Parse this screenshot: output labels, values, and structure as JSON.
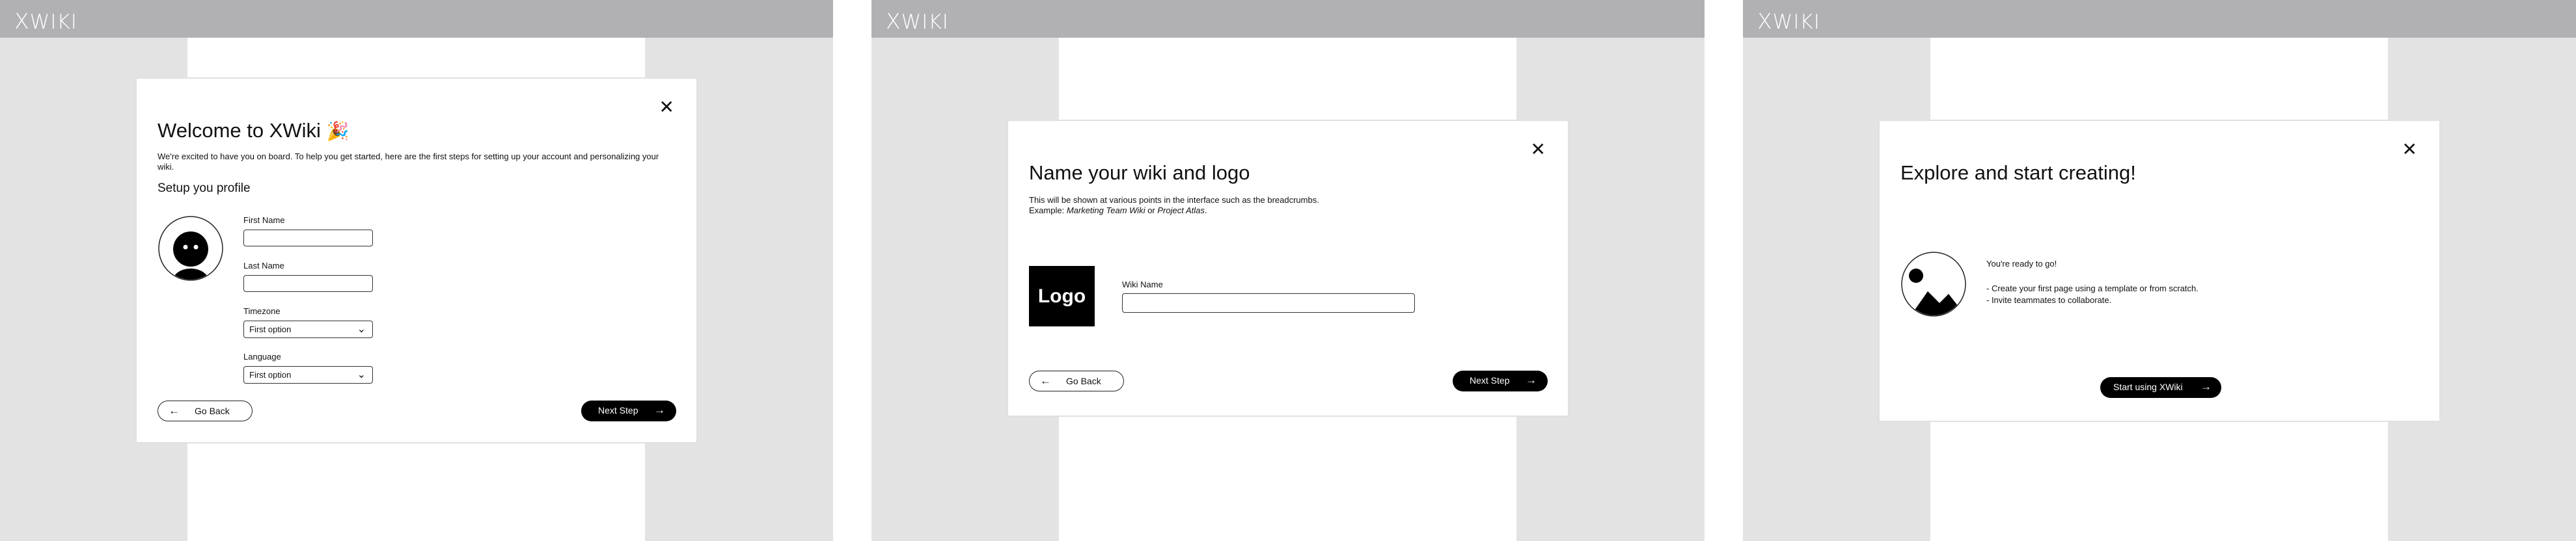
{
  "app": {
    "logo_mark": "X",
    "logo_text": "WIKI"
  },
  "icons": {
    "close": "✕",
    "arrow_left": "←",
    "arrow_right": "→",
    "chevron": "⌄",
    "party": "🎉"
  },
  "step1": {
    "title": "Welcome to XWiki",
    "intro": "We're excited to have you on board. To help you get started, here are the first steps for setting up your account and personalizing your wiki.",
    "section_title": "Setup you profile",
    "first_name_label": "First Name",
    "first_name_value": "",
    "last_name_label": "Last Name",
    "last_name_value": "",
    "timezone_label": "Timezone",
    "timezone_value": "First option",
    "language_label": "Language",
    "language_value": "First option",
    "back_label": "Go Back",
    "next_label": "Next Step"
  },
  "step2": {
    "title": "Name your wiki and logo",
    "desc_line1": "This will be shown at various points in the interface such as the breadcrumbs.",
    "desc_prefix": "Example: ",
    "example1": "Marketing Team Wiki",
    "desc_or": " or ",
    "example2": "Project Atlas",
    "desc_end": ".",
    "logo_label": "Logo",
    "wiki_name_label": "Wiki Name",
    "wiki_name_value": "",
    "back_label": "Go Back",
    "next_label": "Next Step"
  },
  "step3": {
    "title": "Explore and start creating!",
    "ready": "You're ready to go!",
    "bullet1": "- Create your first page using a template or from scratch.",
    "bullet2": "- Invite teammates to collaborate.",
    "start_label": "Start using XWiki"
  }
}
